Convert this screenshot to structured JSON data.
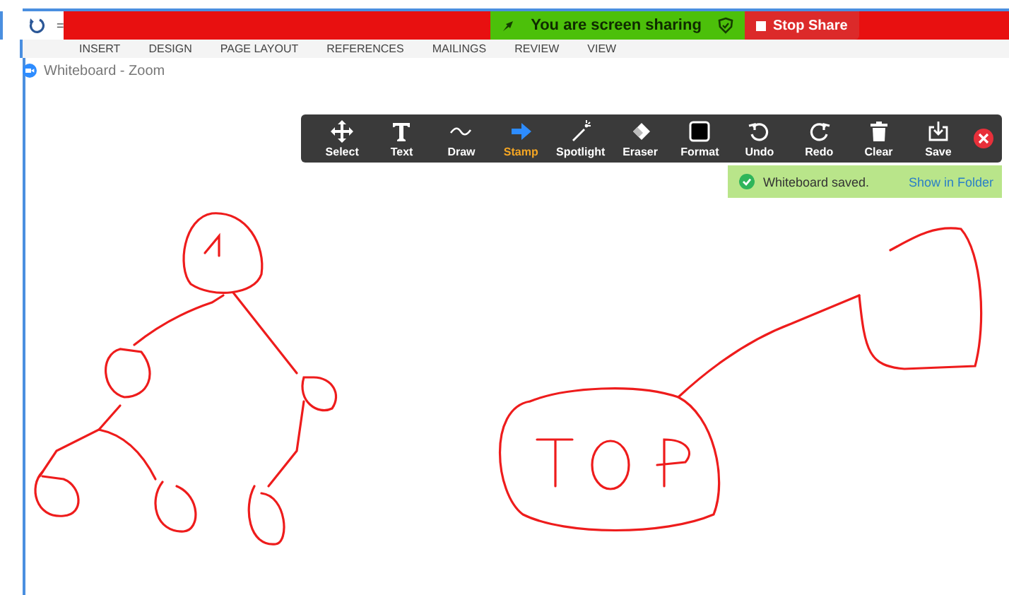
{
  "quick_access": {
    "menu_glyph": "="
  },
  "share_bar": {
    "status": "You are screen sharing",
    "stop_button": "Stop Share"
  },
  "ribbon_tabs": [
    "INSERT",
    "DESIGN",
    "PAGE LAYOUT",
    "REFERENCES",
    "MAILINGS",
    "REVIEW",
    "VIEW"
  ],
  "window": {
    "title": "Whiteboard - Zoom"
  },
  "toolbar": [
    {
      "kind": "select",
      "label": "Select",
      "selected": false
    },
    {
      "kind": "text",
      "label": "Text",
      "selected": false
    },
    {
      "kind": "draw",
      "label": "Draw",
      "selected": false
    },
    {
      "kind": "stamp",
      "label": "Stamp",
      "selected": true
    },
    {
      "kind": "spotlight",
      "label": "Spotlight",
      "selected": false
    },
    {
      "kind": "eraser",
      "label": "Eraser",
      "selected": false
    },
    {
      "kind": "format",
      "label": "Format",
      "selected": false
    },
    {
      "kind": "undo",
      "label": "Undo",
      "selected": false
    },
    {
      "kind": "redo",
      "label": "Redo",
      "selected": false
    },
    {
      "kind": "clear",
      "label": "Clear",
      "selected": false
    },
    {
      "kind": "save",
      "label": "Save",
      "selected": false
    }
  ],
  "notification": {
    "message": "Whiteboard saved.",
    "link": "Show in Folder"
  }
}
